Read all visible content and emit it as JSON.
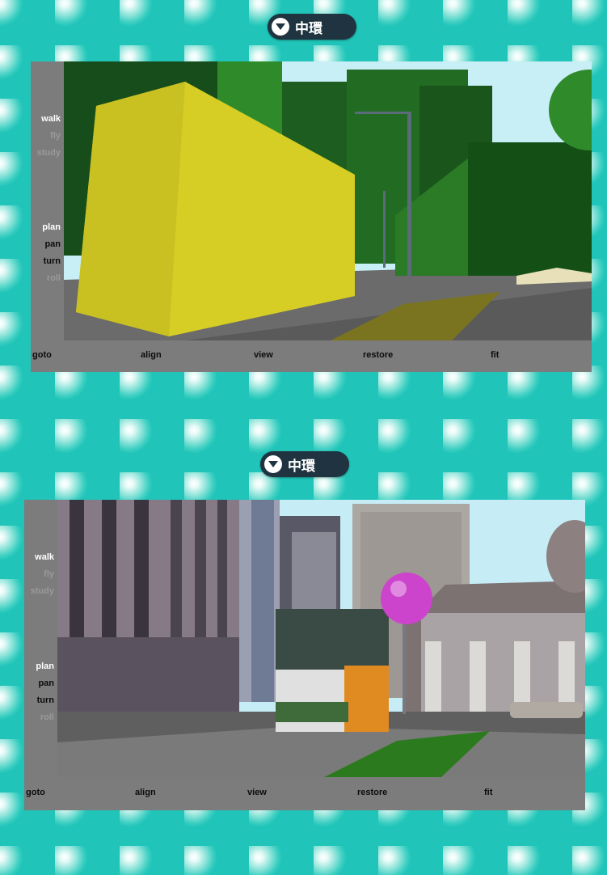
{
  "viewers": [
    {
      "location_label": "中環",
      "nav_modes": [
        {
          "label": "walk",
          "active": true
        },
        {
          "label": "fly",
          "active": false
        },
        {
          "label": "study",
          "active": false
        }
      ],
      "view_tools": [
        {
          "label": "plan",
          "active": true
        },
        {
          "label": "pan",
          "active": false
        },
        {
          "label": "turn",
          "active": false
        },
        {
          "label": "roll",
          "active": false
        }
      ],
      "actions": [
        "goto",
        "align",
        "view",
        "restore",
        "fit"
      ]
    },
    {
      "location_label": "中環",
      "nav_modes": [
        {
          "label": "walk",
          "active": true
        },
        {
          "label": "fly",
          "active": false
        },
        {
          "label": "study",
          "active": false
        }
      ],
      "view_tools": [
        {
          "label": "plan",
          "active": true
        },
        {
          "label": "pan",
          "active": false
        },
        {
          "label": "turn",
          "active": false
        },
        {
          "label": "roll",
          "active": false
        }
      ],
      "actions": [
        "goto",
        "align",
        "view",
        "restore",
        "fit"
      ]
    }
  ],
  "colors": {
    "background": "#20c4b8",
    "panel": "#7c7c7c",
    "active_text": "#ffffff",
    "inactive_text": "#9a9a9a",
    "tool_text": "#0c0c0c",
    "button": "#1f3440"
  },
  "icons": [
    "chevron-down-circle-icon"
  ]
}
